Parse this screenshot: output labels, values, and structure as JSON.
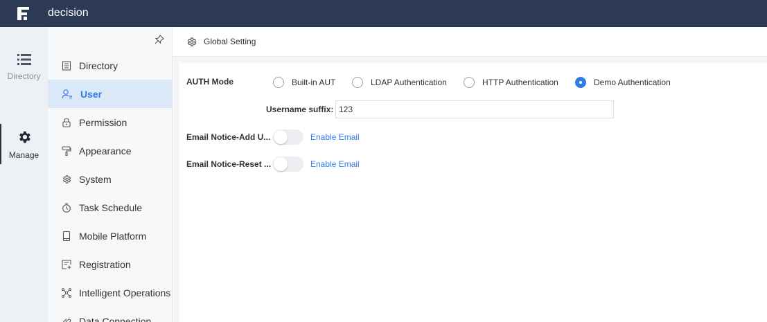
{
  "app": {
    "title": "decision"
  },
  "rail": {
    "items": [
      {
        "label": "Directory",
        "icon": "list-icon",
        "active": false
      },
      {
        "label": "Manage",
        "icon": "gear-icon",
        "active": true
      }
    ]
  },
  "nav": {
    "items": [
      {
        "label": "Directory",
        "icon": "directory-icon"
      },
      {
        "label": "User",
        "icon": "user-icon",
        "active": true
      },
      {
        "label": "Permission",
        "icon": "lock-icon"
      },
      {
        "label": "Appearance",
        "icon": "paint-roller-icon"
      },
      {
        "label": "System",
        "icon": "gear-icon"
      },
      {
        "label": "Task Schedule",
        "icon": "stopwatch-icon"
      },
      {
        "label": "Mobile Platform",
        "icon": "mobile-icon"
      },
      {
        "label": "Registration",
        "icon": "registration-icon"
      },
      {
        "label": "Intelligent Operations",
        "icon": "network-icon"
      },
      {
        "label": "Data Connection",
        "icon": "link-icon"
      }
    ]
  },
  "header": {
    "title": "Global Setting",
    "icon": "gear-icon"
  },
  "settings": {
    "auth_mode": {
      "label": "AUTH Mode",
      "options": [
        {
          "label": "Built-in AUT",
          "checked": false
        },
        {
          "label": "LDAP Authentication",
          "checked": false
        },
        {
          "label": "HTTP Authentication",
          "checked": false
        },
        {
          "label": "Demo Authentication",
          "checked": true
        }
      ]
    },
    "username_suffix": {
      "label": "Username suffix:",
      "value": "123"
    },
    "email_add": {
      "label": "Email Notice-Add U...",
      "enabled": false,
      "link": "Enable Email"
    },
    "email_reset": {
      "label": "Email Notice-Reset ...",
      "enabled": false,
      "link": "Enable Email"
    }
  },
  "colors": {
    "topbar": "#2c3a55",
    "accent": "#2f7ce6",
    "active_nav_bg": "#dbe8f8"
  }
}
